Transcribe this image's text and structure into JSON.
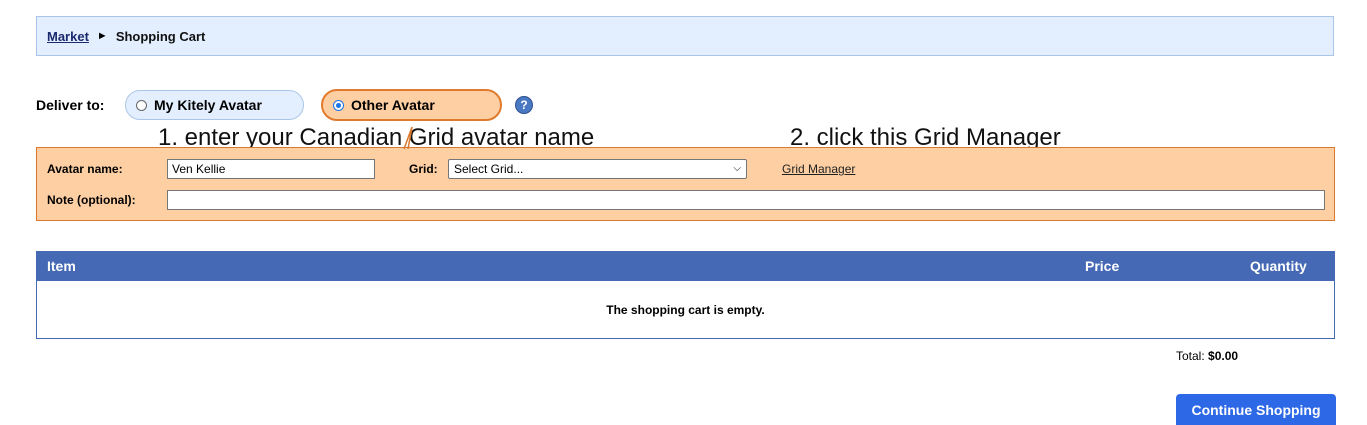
{
  "breadcrumb": {
    "market": "Market",
    "separator": "►",
    "current": "Shopping Cart"
  },
  "deliver": {
    "label": "Deliver to:",
    "option_mine": "My Kitely Avatar",
    "option_other": "Other Avatar",
    "selected": "Other Avatar",
    "help": "?"
  },
  "annotations": {
    "step1": "1. enter your Canadian Grid avatar name",
    "step2": "2. click this Grid Manager"
  },
  "form": {
    "avatar_label": "Avatar name:",
    "avatar_value": "Ven Kellie",
    "grid_label": "Grid:",
    "grid_selected": "Select Grid...",
    "grid_manager_link": "Grid Manager",
    "note_label": "Note (optional):",
    "note_value": ""
  },
  "cart": {
    "columns": {
      "item": "Item",
      "price": "Price",
      "quantity": "Quantity"
    },
    "empty_message": "The shopping cart is empty.",
    "total_label": "Total:",
    "total_value": "$0.00"
  },
  "buttons": {
    "continue": "Continue Shopping"
  },
  "colors": {
    "accent_blue": "#4569b5",
    "form_orange": "#fdcfa3",
    "breadcrumb_bg": "#e3efff",
    "button_blue": "#2d68e6"
  }
}
